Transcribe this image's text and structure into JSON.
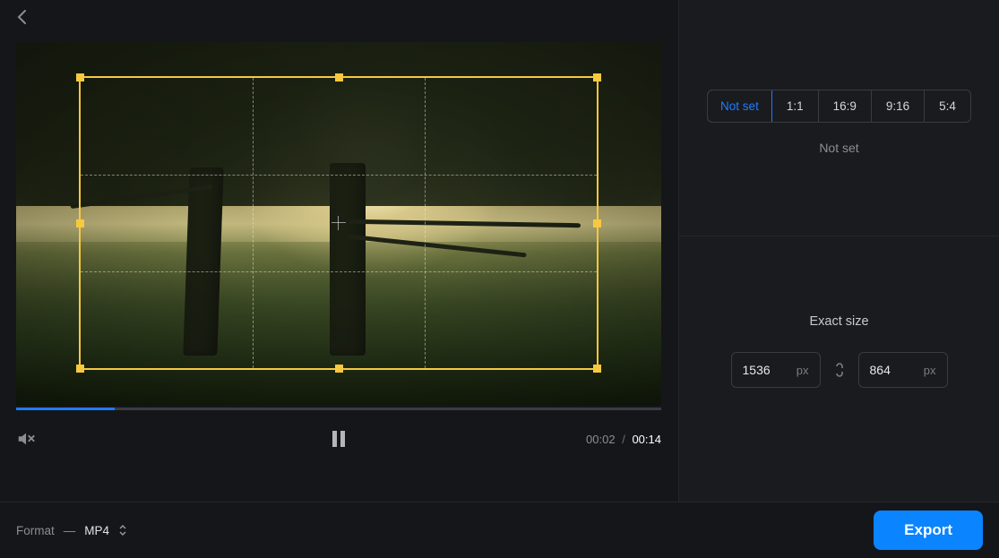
{
  "player": {
    "current_time": "00:02",
    "duration": "00:14",
    "separator": "/",
    "progress_percent": 15.3
  },
  "crop": {
    "aspect_ratios": [
      "Not set",
      "1:1",
      "16:9",
      "9:16",
      "5:4"
    ],
    "selected_ratio": "Not set",
    "caption": "Not set"
  },
  "exact_size": {
    "label": "Exact size",
    "width": "1536",
    "height": "864",
    "unit": "px"
  },
  "footer": {
    "format_label": "Format",
    "format_dash": "—",
    "format_value": "MP4",
    "export_label": "Export"
  }
}
